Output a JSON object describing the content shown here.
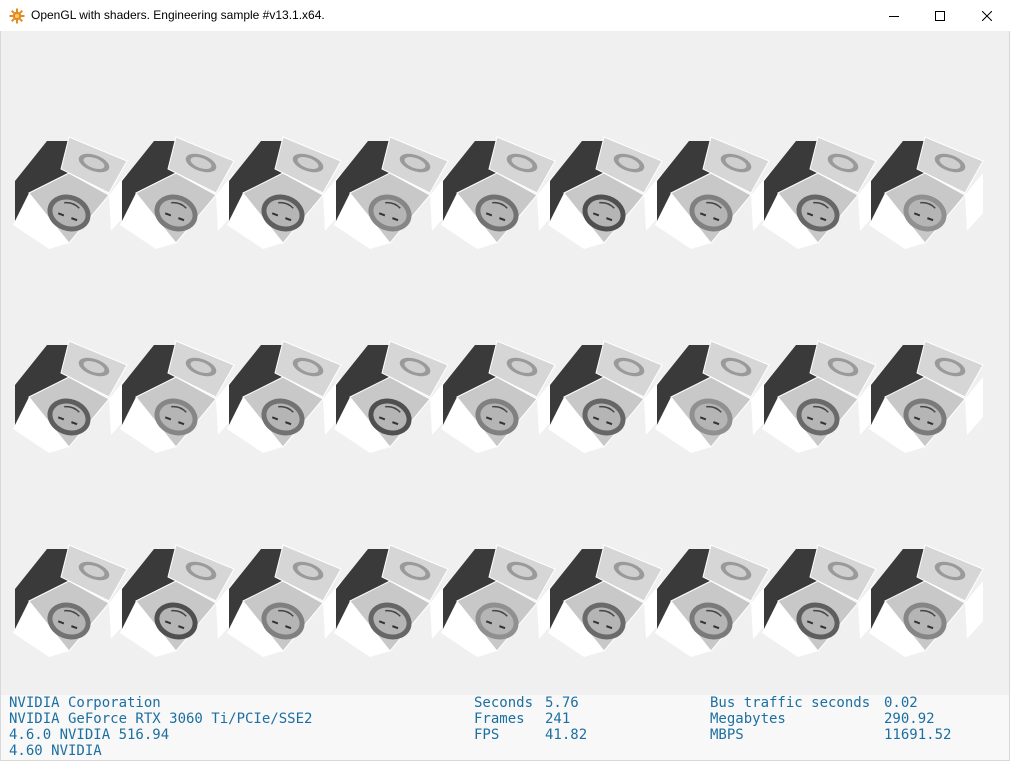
{
  "window": {
    "title": "OpenGL with shaders. Engineering sample #v13.1.x64.",
    "icons": {
      "app": "gear-sun-icon",
      "minimize": "minimize-icon",
      "maximize": "maximize-icon",
      "close": "close-icon"
    }
  },
  "scene": {
    "rows": 3,
    "columns": 9,
    "background_color": "#f0f0f0",
    "cube_texture": "grayscale portrait photo"
  },
  "status": {
    "text_color": "#1c6fa2",
    "gpu_info": [
      "NVIDIA Corporation",
      "NVIDIA GeForce RTX 3060 Ti/PCIe/SSE2",
      "4.6.0 NVIDIA 516.94",
      "4.60 NVIDIA"
    ],
    "timing": [
      {
        "label": "Seconds",
        "value": "5.76"
      },
      {
        "label": "Frames",
        "value": "241"
      },
      {
        "label": "FPS",
        "value": "41.82"
      }
    ],
    "bus": [
      {
        "label": "Bus traffic seconds",
        "value": "0.02"
      },
      {
        "label": "Megabytes",
        "value": "290.92"
      },
      {
        "label": "MBPS",
        "value": "11691.52"
      }
    ]
  }
}
